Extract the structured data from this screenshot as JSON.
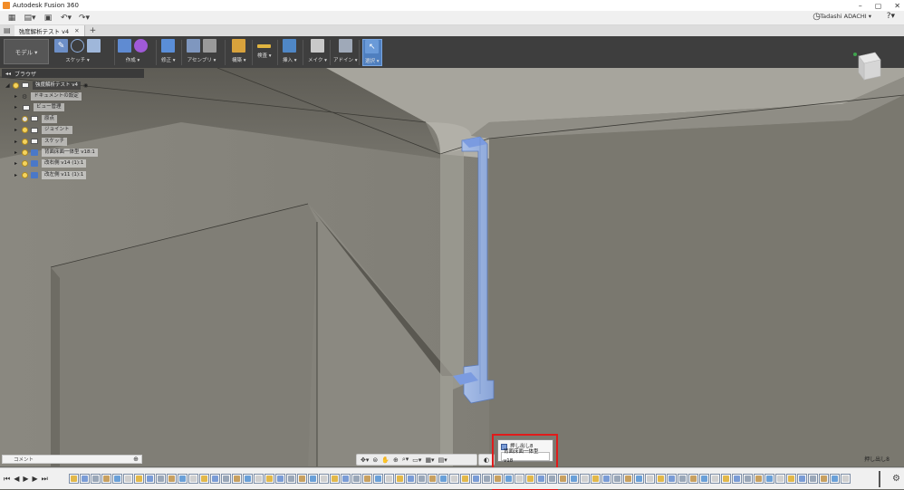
{
  "window": {
    "title": "Autodesk Fusion 360",
    "minimize": "–",
    "maximize": "▢",
    "close": "✕"
  },
  "qat": {
    "user": "Tadashi ADACHI ▾",
    "help": "?▾"
  },
  "doc_tab": {
    "label": "強度解析テスト v4",
    "plus": "+"
  },
  "ribbon": {
    "workspace": "モデル ▾",
    "groups": [
      {
        "label": "スケッチ ▾"
      },
      {
        "label": "作成 ▾"
      },
      {
        "label": "修正 ▾"
      },
      {
        "label": "アセンブリ ▾"
      },
      {
        "label": "構築 ▾"
      },
      {
        "label": "検査 ▾"
      },
      {
        "label": "挿入 ▾"
      },
      {
        "label": "メイク ▾"
      },
      {
        "label": "アドイン ▾"
      },
      {
        "label": "選択 ▾"
      }
    ]
  },
  "browser": {
    "title": "ブラウザ",
    "items": [
      {
        "label": "強度解析テスト v4"
      },
      {
        "label": "ドキュメントの設定"
      },
      {
        "label": "ビュー管理"
      },
      {
        "label": "原点"
      },
      {
        "label": "ジョイント"
      },
      {
        "label": "スケッチ"
      },
      {
        "label": "背面床面一体型 v18:1"
      },
      {
        "label": "改右側 v14 (1):1"
      },
      {
        "label": "改左側 v11 (1):1"
      }
    ]
  },
  "comments": {
    "label": "コメント",
    "plus": "⊕"
  },
  "status": {
    "label": "押し出し8"
  },
  "tooltip": {
    "line1": "押し出し8",
    "line2": "背面床面一体型 v18"
  },
  "timeline": {
    "controls": [
      "⏮",
      "◀",
      "▶",
      "▶",
      "⏭"
    ],
    "gear": "⚙"
  },
  "colors": {
    "ribbon_bg": "#3e3e3e",
    "highlight_box": "#e01b1b",
    "selected_body": "#9ab3e6"
  },
  "icons": {
    "app": "fusion-logo-icon",
    "grid": "app-grid-icon",
    "file": "file-icon",
    "save": "save-icon",
    "undo": "undo-icon",
    "redo": "redo-icon",
    "clock": "job-status-icon",
    "viewcube": "viewcube-icon"
  }
}
